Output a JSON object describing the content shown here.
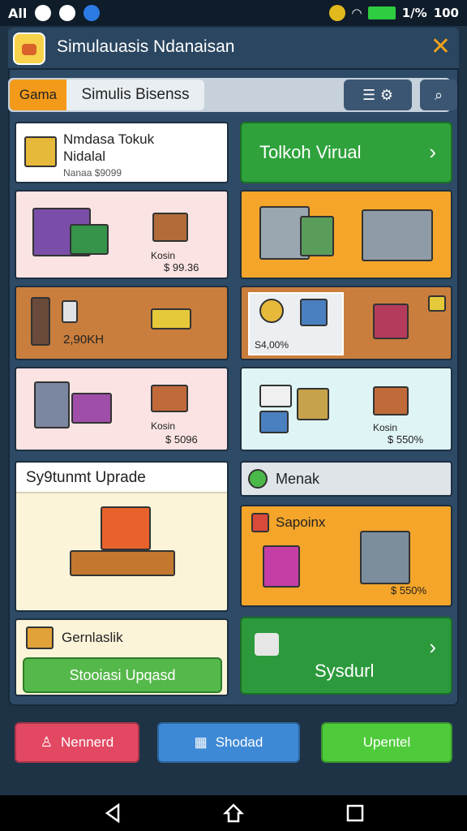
{
  "status": {
    "left_text": "All",
    "right_text": "1/% ",
    "battery_text": "100"
  },
  "header": {
    "title": "Simulauasis Ndanaisan"
  },
  "toolbar": {
    "tab_game": "Gama",
    "tab_sim": "Simulis Bisenss"
  },
  "cards": {
    "top_left": {
      "title_line1": "Nmdasa Tokuk",
      "title_line2": "Nidalal",
      "subtitle": "Nanaa $9099"
    },
    "top_right_button": "Tolkoh Virual",
    "row1_left": {
      "name": "Kosin",
      "price": "$ 99.36"
    },
    "row2_left": {
      "value": "2,90KH"
    },
    "row2_right": {
      "value": "S4,00%"
    },
    "row3_left": {
      "name": "Kosin",
      "price": "$ 5096"
    },
    "row3_right": {
      "name": "Kosin",
      "price": "$ 550%"
    },
    "upgrade": {
      "title": "Sy9tunmt Uprade"
    },
    "menu_bar": {
      "label": "Menak"
    },
    "sapoinx": {
      "title": "Sapoinx",
      "price": "$ 550%"
    },
    "gernlaslik": {
      "title": "Gernlaslik",
      "button": "Stooiasi Upqasd"
    },
    "sysdurl": {
      "label": "Sysdurl"
    }
  },
  "footer": {
    "btn1": "Nennerd",
    "btn2": "Shodad",
    "btn3": "Upentel"
  },
  "colors": {
    "green": "#2fa23c",
    "orange": "#f4a52a",
    "pink": "#fbe3e3",
    "brown": "#c97e3d",
    "red_btn": "#e34862",
    "blue_btn": "#3e89d6",
    "green_btn": "#4fca3b"
  }
}
